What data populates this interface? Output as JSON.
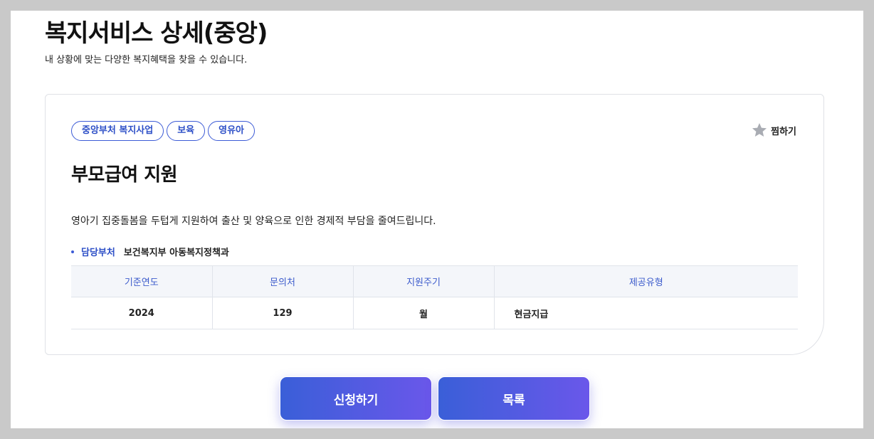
{
  "header": {
    "title": "복지서비스 상세(중앙)",
    "subtitle": "내 상황에 맞는 다양한 복지혜택을 찾을 수 있습니다."
  },
  "card": {
    "tags": [
      "중앙부처 복지사업",
      "보육",
      "영유아"
    ],
    "bookmark_label": "찜하기",
    "bookmark_icon": "star-icon",
    "service_title": "부모급여 지원",
    "description": "영아기 집중돌봄을 두텁게 지원하여 출산 및 양육으로 인한 경제적 부담을 줄여드립니다.",
    "department": {
      "label": "담당부처",
      "value": "보건복지부 아동복지정책과"
    },
    "table": {
      "headers": [
        "기준연도",
        "문의처",
        "지원주기",
        "제공유형"
      ],
      "row": [
        "2024",
        "129",
        "월",
        "현금지급"
      ]
    }
  },
  "actions": {
    "apply_label": "신청하기",
    "list_label": "목록"
  },
  "colors": {
    "accent": "#3c5bd6",
    "button_gradient_start": "#3a5fd8",
    "button_gradient_end": "#6a57ea",
    "table_header_bg": "#f4f6fa"
  }
}
